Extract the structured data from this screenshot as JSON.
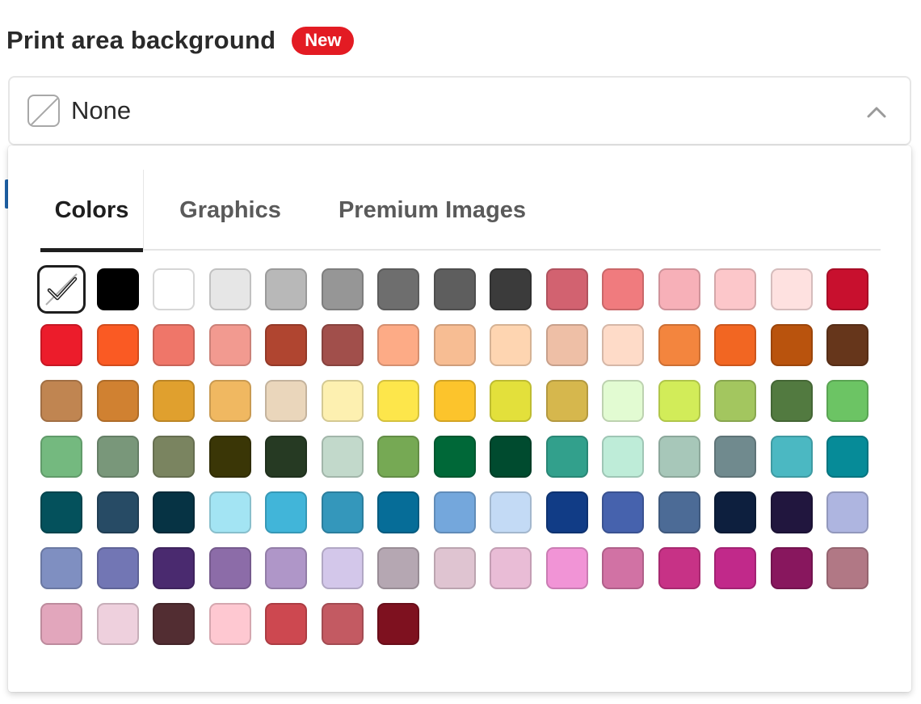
{
  "header": {
    "title": "Print area background",
    "badge": "New"
  },
  "select": {
    "value": "None",
    "icon": "none-slash-icon",
    "chevron": "chevron-up-icon"
  },
  "tabs": [
    {
      "label": "Colors",
      "active": true
    },
    {
      "label": "Graphics",
      "active": false
    },
    {
      "label": "Premium Images",
      "active": false
    }
  ],
  "swatches": {
    "selected_index": 0,
    "colors": [
      "#ffffff",
      "#000000",
      "#ffffff",
      "#e6e6e6",
      "#b8b8b8",
      "#969696",
      "#6e6e6e",
      "#5e5e5e",
      "#3b3b3b",
      "#d26270",
      "#f07b7e",
      "#f7b0b8",
      "#fcc7ca",
      "#fee1e0",
      "#c8102e",
      "#ec1c2b",
      "#fa5a23",
      "#ef7669",
      "#f29a90",
      "#b04530",
      "#a14f4b",
      "#fdab86",
      "#f7bd93",
      "#fed5b1",
      "#eebfa6",
      "#fedbc8",
      "#f3853e",
      "#f26622",
      "#b9530d",
      "#66361b",
      "#c08551",
      "#d08131",
      "#e0a02e",
      "#f0b861",
      "#ead6bb",
      "#fdf0b0",
      "#fde64b",
      "#fcc42c",
      "#e3e03b",
      "#d6b74d",
      "#e2fbd2",
      "#d2ec59",
      "#a3c65f",
      "#527a40",
      "#6cc464",
      "#74b97f",
      "#79977a",
      "#7a8460",
      "#3a3606",
      "#263a23",
      "#c2d9cb",
      "#76a954",
      "#006838",
      "#004b2f",
      "#32a08c",
      "#beecd8",
      "#a7c7b9",
      "#708a8e",
      "#4bb8c2",
      "#068b98",
      "#04515c",
      "#274b65",
      "#063344",
      "#a3e4f3",
      "#41b5d9",
      "#3497bb",
      "#066d98",
      "#74a7dc",
      "#c3daf5",
      "#113c86",
      "#4662ad",
      "#4c6b96",
      "#0d1f3e",
      "#21163e",
      "#aeb5e0",
      "#7f8fc1",
      "#7276b4",
      "#4a2a6f",
      "#8c6ca8",
      "#af96c8",
      "#d3c7ea",
      "#b5a7b2",
      "#dfc4d1",
      "#e9bcd6",
      "#f194d6",
      "#d172a4",
      "#c73286",
      "#c1298a",
      "#88175e",
      "#b17885",
      "#e2a6bc",
      "#eed0dd",
      "#522d32",
      "#fec8d1",
      "#cd4850",
      "#c35a62",
      "#7e111f"
    ]
  }
}
